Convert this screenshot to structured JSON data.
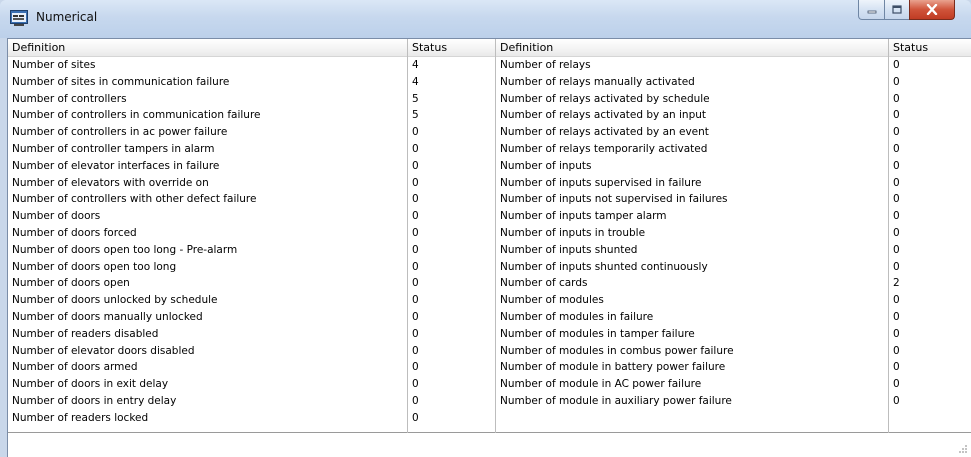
{
  "window": {
    "title": "Numerical",
    "icon": "app-window-icon",
    "controls": [
      "minimize-icon",
      "maximize-icon",
      "close-icon"
    ]
  },
  "table": {
    "headers": [
      "Definition",
      "Status",
      "Definition",
      "Status"
    ],
    "left": [
      {
        "definition": "Number of sites",
        "status": "4"
      },
      {
        "definition": "Number of sites in communication failure",
        "status": "4"
      },
      {
        "definition": "Number of controllers",
        "status": "5"
      },
      {
        "definition": "Number of controllers in communication failure",
        "status": "5"
      },
      {
        "definition": "Number of controllers in ac power failure",
        "status": "0"
      },
      {
        "definition": "Number of controller tampers in alarm",
        "status": "0"
      },
      {
        "definition": "Number of elevator interfaces in failure",
        "status": "0"
      },
      {
        "definition": "Number of elevators with override on",
        "status": "0"
      },
      {
        "definition": "Number of controllers with other defect failure",
        "status": "0"
      },
      {
        "definition": "Number of doors",
        "status": "0"
      },
      {
        "definition": "Number of doors forced",
        "status": "0"
      },
      {
        "definition": "Number of doors open too long - Pre-alarm",
        "status": "0"
      },
      {
        "definition": "Number of doors open too long",
        "status": "0"
      },
      {
        "definition": "Number of doors open",
        "status": "0"
      },
      {
        "definition": "Number of doors unlocked by schedule",
        "status": "0"
      },
      {
        "definition": "Number of doors manually unlocked",
        "status": "0"
      },
      {
        "definition": "Number of readers disabled",
        "status": "0"
      },
      {
        "definition": "Number of elevator doors disabled",
        "status": "0"
      },
      {
        "definition": "Number of doors armed",
        "status": "0"
      },
      {
        "definition": "Number of doors in exit delay",
        "status": "0"
      },
      {
        "definition": "Number of doors in entry delay",
        "status": "0"
      },
      {
        "definition": "Number of readers locked",
        "status": "0"
      }
    ],
    "right": [
      {
        "definition": "Number of relays",
        "status": "0"
      },
      {
        "definition": "Number of relays manually activated",
        "status": "0"
      },
      {
        "definition": "Number of relays activated by schedule",
        "status": "0"
      },
      {
        "definition": "Number of relays activated by an input",
        "status": "0"
      },
      {
        "definition": "Number of relays activated by an event",
        "status": "0"
      },
      {
        "definition": "Number of relays temporarily activated",
        "status": "0"
      },
      {
        "definition": "Number of inputs",
        "status": "0"
      },
      {
        "definition": "Number of inputs supervised in failure",
        "status": "0"
      },
      {
        "definition": "Number of inputs not supervised in failures",
        "status": "0"
      },
      {
        "definition": "Number of inputs tamper alarm",
        "status": "0"
      },
      {
        "definition": "Number of inputs in trouble",
        "status": "0"
      },
      {
        "definition": "Number of inputs shunted",
        "status": "0"
      },
      {
        "definition": "Number of inputs shunted continuously",
        "status": "0"
      },
      {
        "definition": "Number of cards",
        "status": "2"
      },
      {
        "definition": "Number of modules",
        "status": "0"
      },
      {
        "definition": "Number of modules in failure",
        "status": "0"
      },
      {
        "definition": "Number of modules in tamper failure",
        "status": "0"
      },
      {
        "definition": "Number of modules in combus power failure",
        "status": "0"
      },
      {
        "definition": "Number of module in battery power failure",
        "status": "0"
      },
      {
        "definition": "Number of module in AC power failure",
        "status": "0"
      },
      {
        "definition": "Number of module in auxiliary power failure",
        "status": "0"
      }
    ]
  },
  "statusbar": {
    "grip_icon": "resize-grip-icon"
  }
}
